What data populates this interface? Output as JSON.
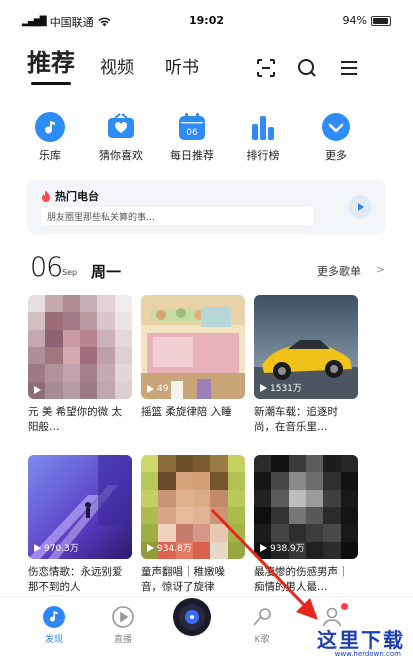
{
  "status_bar": {
    "carrier": "中国联通",
    "time": "19:02",
    "battery": "94%",
    "battery_level": 0.94
  },
  "header": {
    "tabs": [
      "推荐",
      "视频",
      "听书"
    ],
    "active_tab": 0,
    "icons": [
      "scan-icon",
      "search-icon",
      "menu-icon"
    ]
  },
  "shortcuts": [
    {
      "label": "乐库",
      "icon": "music-note-icon"
    },
    {
      "label": "猜你喜欢",
      "icon": "heart-radio-icon"
    },
    {
      "label": "每日推荐",
      "icon": "calendar-icon",
      "icon_text": "06"
    },
    {
      "label": "排行榜",
      "icon": "chart-bars-icon"
    },
    {
      "label": "更多",
      "icon": "chevron-down-icon"
    }
  ],
  "hot_radio": {
    "title": "热门电台",
    "desc": "朋友圈里那些私关算的事…"
  },
  "daily": {
    "day": "06",
    "month": "Sep",
    "weekday": "周一",
    "more": "更多歌单"
  },
  "cards": [
    {
      "count": "",
      "caption": "元  美  希望你的微  太阳般…"
    },
    {
      "count": "49",
      "caption": "摇篮  柔旋律陪  入睡"
    },
    {
      "count": "1531万",
      "caption": "新潮车载：追逐时尚，在音乐里…"
    },
    {
      "count": "970.3万",
      "caption": "伤恋情歌：永远别爱那不到的人"
    },
    {
      "count": "934.8万",
      "caption": "童声翻唱｜稚嫩噪音，惊讶了旋律"
    },
    {
      "count": "938.9万",
      "caption": "最凄惨的伤感男声｜痴情的男人最…"
    }
  ],
  "nav": [
    {
      "label": "发现",
      "icon": "discover-icon",
      "active": true
    },
    {
      "label": "直播",
      "icon": "live-play-icon",
      "active": false
    },
    {
      "label": "",
      "icon": "vinyl-disc-icon",
      "active": false
    },
    {
      "label": "K歌",
      "icon": "karaoke-mic-icon",
      "active": false
    },
    {
      "label": "",
      "icon": "profile-icon",
      "active": false
    }
  ],
  "watermark": {
    "text": "这里下载",
    "sub": "www.herdown.com"
  },
  "colors": {
    "accent": "#2e86ff",
    "badge": "#ff3b4b",
    "arrow": "#e8261b"
  }
}
